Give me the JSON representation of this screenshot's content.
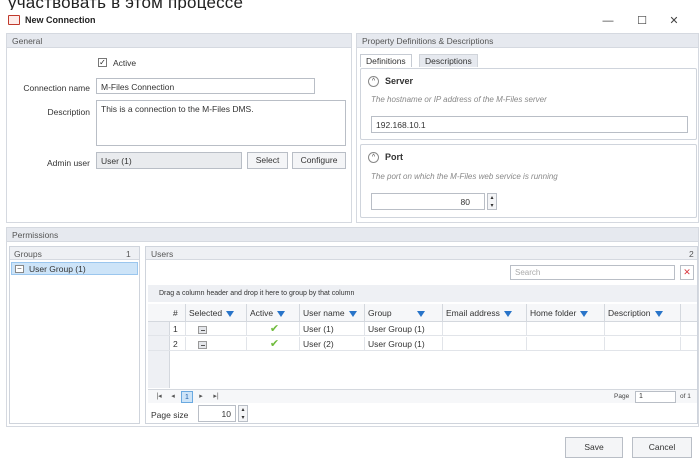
{
  "background_caption": "участвовать в этом процессе",
  "window": {
    "title": "New Connection",
    "minimize": "—",
    "maximize": "☐",
    "close": "✕"
  },
  "general": {
    "header": "General",
    "active_label": "Active",
    "active_checked": true,
    "connection_name_label": "Connection name",
    "connection_name_value": "M-Files Connection",
    "description_label": "Description",
    "description_value": "This is a connection to the M-Files DMS.",
    "admin_user_label": "Admin user",
    "admin_user_value": "User (1)",
    "select_button": "Select",
    "configure_button": "Configure"
  },
  "properties": {
    "header": "Property Definitions & Descriptions",
    "tabs": [
      {
        "label": "Definitions",
        "active": true
      },
      {
        "label": "Descriptions",
        "active": false
      }
    ],
    "server": {
      "title": "Server",
      "description": "The hostname or IP address of the M-Files server",
      "value": "192.168.10.1"
    },
    "port": {
      "title": "Port",
      "description": "The port on which the M-Files web service is running",
      "value": "80"
    }
  },
  "permissions": {
    "header": "Permissions",
    "groups": {
      "title": "Groups",
      "count": "1",
      "items": [
        "User Group (1)"
      ]
    },
    "users": {
      "title": "Users",
      "count": "2",
      "search_placeholder": "Search",
      "group_hint": "Drag a column header and drop it here to group by that column",
      "columns": [
        "#",
        "Selected",
        "Active",
        "User name",
        "Group",
        "Email address",
        "Home folder",
        "Description"
      ],
      "rows": [
        {
          "num": "1",
          "user": "User (1)",
          "group": "User Group (1)"
        },
        {
          "num": "2",
          "user": "User (2)",
          "group": "User Group (1)"
        }
      ],
      "pager": {
        "first": "|◂",
        "prev": "◂",
        "current": "1",
        "next": "▸",
        "last": "▸|",
        "page_label": "Page",
        "page_value": "1",
        "of_label": "of 1"
      },
      "page_size_label": "Page size",
      "page_size_value": "10"
    }
  },
  "footer": {
    "save": "Save",
    "cancel": "Cancel"
  },
  "colors": {
    "accent": "#2874c9",
    "header_bg": "#e6e9ef",
    "check_green": "#6fbb3c",
    "close_red": "#d9363e"
  }
}
